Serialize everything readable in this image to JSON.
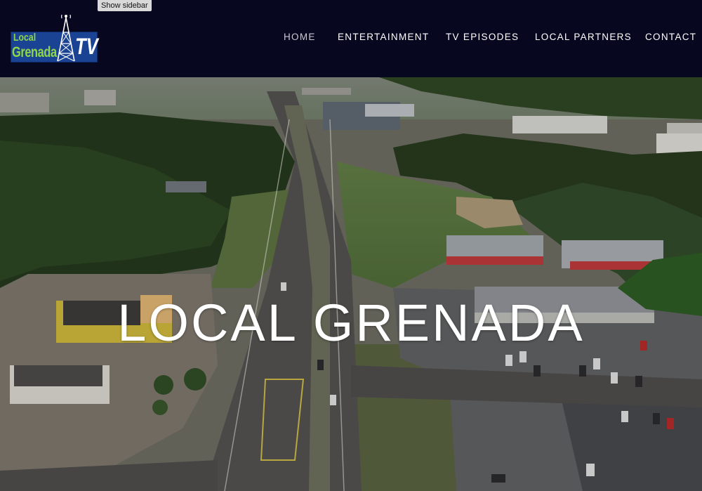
{
  "topbar": {
    "show_sidebar_label": "Show sidebar"
  },
  "logo": {
    "line1": "Local",
    "line2": "Grenada",
    "suffix": "TV",
    "icon": "radio-tower-icon"
  },
  "nav": {
    "items": [
      {
        "label": "HOME",
        "active": true
      },
      {
        "label": "ENTERTAINMENT",
        "active": false
      },
      {
        "label": "TV EPISODES",
        "active": false
      },
      {
        "label": "LOCAL PARTNERS",
        "active": false
      },
      {
        "label": "CONTACT",
        "active": false
      }
    ]
  },
  "hero": {
    "title": "LOCAL GRENADA"
  },
  "colors": {
    "header_bg": "#07071f",
    "logo_green": "#8ed64a",
    "logo_blue": "#1b4393",
    "nav_text": "#ffffff",
    "nav_active": "#c9c9d4"
  }
}
